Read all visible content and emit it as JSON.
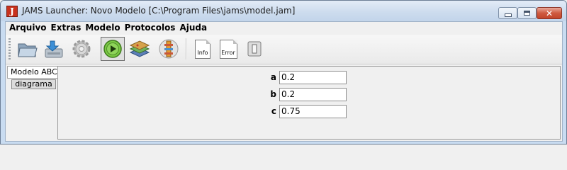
{
  "window": {
    "title": "JAMS Launcher: Novo Modelo [C:\\Program Files\\jams\\model.jam]",
    "app_icon_glyph": "J",
    "controls": {
      "minimize_icon": "minimize-icon",
      "maximize_icon": "maximize-icon",
      "close_glyph": "✕"
    }
  },
  "menu": {
    "items": [
      {
        "label": "Arquivo"
      },
      {
        "label": "Extras"
      },
      {
        "label": "Modelo"
      },
      {
        "label": "Protocolos"
      },
      {
        "label": "Ajuda"
      }
    ]
  },
  "toolbar": {
    "buttons": [
      {
        "icon": "open-folder-icon"
      },
      {
        "icon": "save-icon"
      },
      {
        "icon": "settings-gear-icon"
      },
      {
        "icon": "run-play-icon",
        "pressed": true
      },
      {
        "icon": "layers-map-icon"
      },
      {
        "icon": "model-tree-icon"
      },
      {
        "icon": "info-document-icon",
        "label": "Info"
      },
      {
        "icon": "error-document-icon",
        "label": "Error"
      },
      {
        "icon": "stop-toggle-icon"
      }
    ]
  },
  "tabs": {
    "main_tab": "Modelo ABC",
    "sub_tab": "diagrama"
  },
  "parameters": [
    {
      "name": "a",
      "value": "0.2"
    },
    {
      "name": "b",
      "value": "0.2"
    },
    {
      "name": "c",
      "value": "0.75"
    }
  ],
  "colors": {
    "title_bar": "#cddcee",
    "close_button": "#cf5a40",
    "app_icon": "#c8321e",
    "run_button": "#7ac943"
  }
}
